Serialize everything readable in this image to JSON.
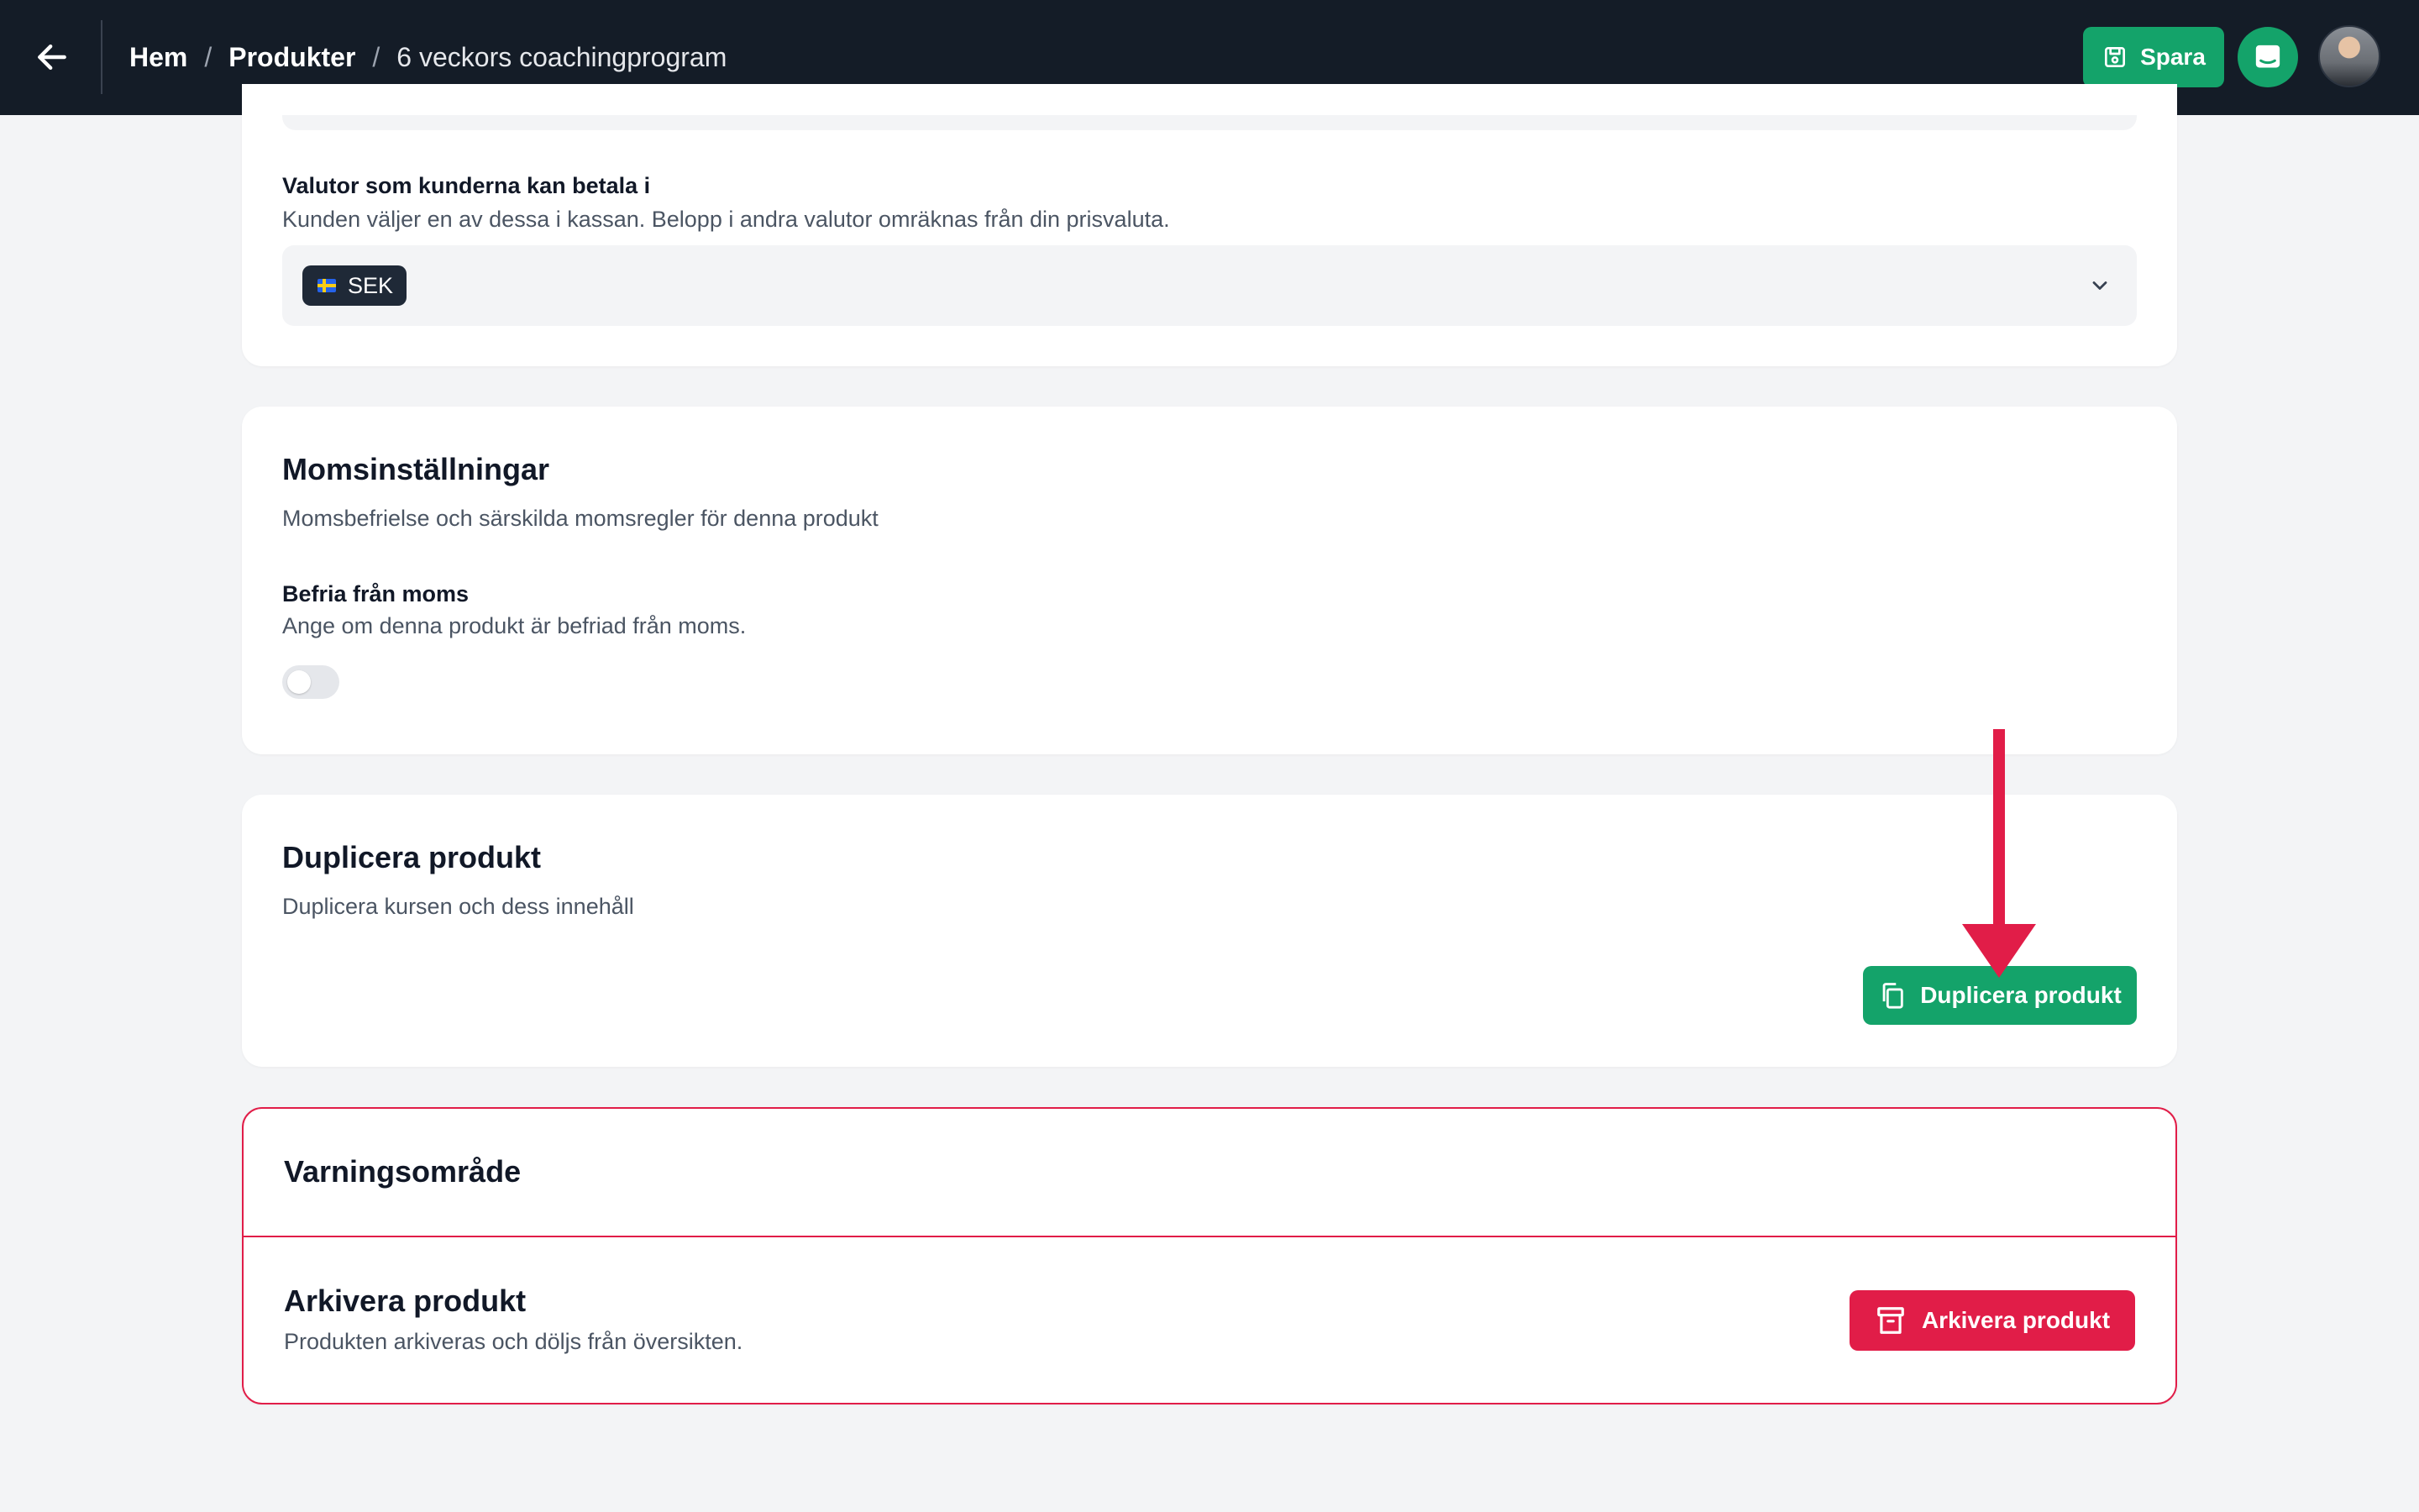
{
  "topbar": {
    "back_icon": "arrow-left-icon",
    "breadcrumb": [
      {
        "label": "Hem"
      },
      {
        "label": "Produkter"
      },
      {
        "label": "6 veckors coachingprogram"
      }
    ],
    "separator": "/",
    "save_label": "Spara",
    "save_icon": "floppy-disk-icon",
    "chat_icon": "chat-icon",
    "colors": {
      "background": "#141c27",
      "accent": "#14a36a"
    }
  },
  "currency": {
    "label": "Valutor som kunderna kan betala i",
    "help": "Kunden väljer en av dessa i kassan. Belopp i andra valutor omräknas från din prisvaluta.",
    "selected": [
      {
        "code": "SEK",
        "flag": "sweden-flag-icon"
      }
    ]
  },
  "vat": {
    "title": "Momsinställningar",
    "subtitle": "Momsbefrielse och särskilda momsregler för denna produkt",
    "exempt_label": "Befria från moms",
    "exempt_help": "Ange om denna produkt är befriad från moms.",
    "exempt_enabled": false
  },
  "duplicate": {
    "title": "Duplicera produkt",
    "subtitle": "Duplicera kursen och dess innehåll",
    "button_label": "Duplicera produkt",
    "button_icon": "copy-icon"
  },
  "danger_zone": {
    "title": "Varningsområde",
    "archive_title": "Arkivera produkt",
    "archive_help": "Produkten arkiveras och döljs från översikten.",
    "archive_button": "Arkivera produkt",
    "archive_icon": "archive-box-icon",
    "color": "#e11d48"
  }
}
